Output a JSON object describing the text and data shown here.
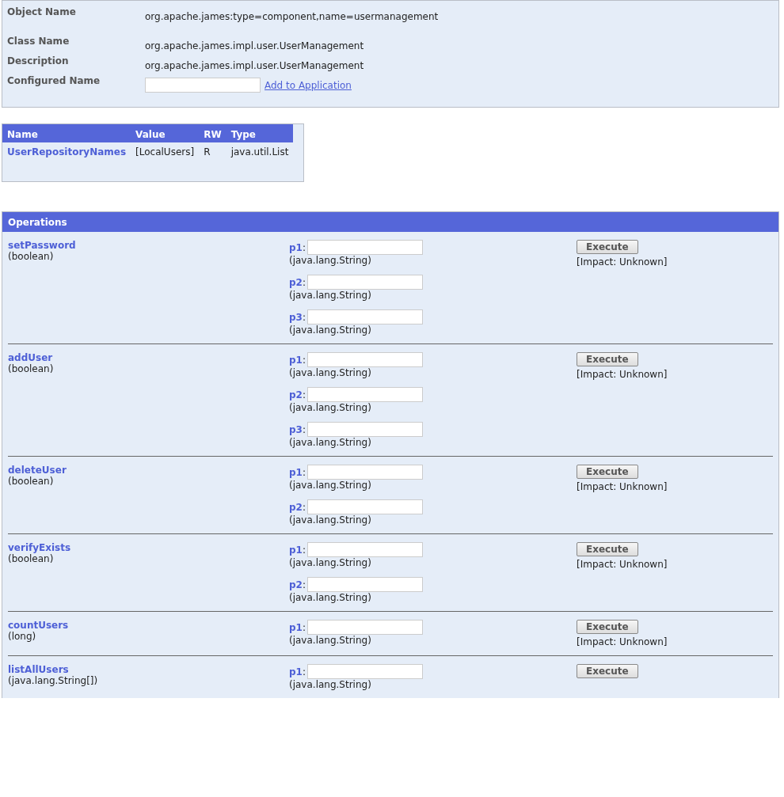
{
  "object_info": {
    "fields": [
      {
        "label": "Object Name",
        "value": "org.apache.james:type=component,name=usermanagement"
      },
      {
        "label": "Class Name",
        "value": "org.apache.james.impl.user.UserManagement"
      },
      {
        "label": "Description",
        "value": "org.apache.james.impl.user.UserManagement"
      }
    ],
    "configured_name": {
      "label": "Configured Name",
      "link": "Add to Application"
    }
  },
  "attributes": {
    "columns": [
      "Name",
      "Value",
      "RW",
      "Type"
    ],
    "rows": [
      [
        "UserRepositoryNames",
        "[LocalUsers]",
        "R",
        "java.util.List"
      ]
    ]
  },
  "operations": {
    "title": "Operations",
    "items": [
      {
        "name": "setPassword",
        "return_type": "(boolean)",
        "params": [
          {
            "label": "**p1**:",
            "type": "(java.lang.String)"
          },
          {
            "label": "**p2**:",
            "type": "(java.lang.String)"
          },
          {
            "label": "**p3**:",
            "type": "(java.lang.String)"
          }
        ],
        "button": "Execute",
        "impact": "[Impact: Unknown]"
      },
      {
        "name": "addUser",
        "return_type": "(boolean)",
        "params": [
          {
            "label": "**p1**:",
            "type": "(java.lang.String)"
          },
          {
            "label": "**p2**:",
            "type": "(java.lang.String)"
          },
          {
            "label": "**p3**:",
            "type": "(java.lang.String)"
          }
        ],
        "button": "Execute",
        "impact": "[Impact: Unknown]"
      },
      {
        "name": "deleteUser",
        "return_type": "(boolean)",
        "params": [
          {
            "label": "**p1**:",
            "type": "(java.lang.String)"
          },
          {
            "label": "**p2**:",
            "type": "(java.lang.String)"
          }
        ],
        "button": "Execute",
        "impact": "[Impact: Unknown]"
      },
      {
        "name": "verifyExists",
        "return_type": "(boolean)",
        "params": [
          {
            "label": "**p1**:",
            "type": "(java.lang.String)"
          },
          {
            "label": "**p2**:",
            "type": "(java.lang.String)"
          }
        ],
        "button": "Execute",
        "impact": "[Impact: Unknown]"
      },
      {
        "name": "countUsers",
        "return_type": "(long)",
        "params": [
          {
            "label": "**p1**:",
            "type": "(java.lang.String)"
          }
        ],
        "button": "Execute",
        "impact": "[Impact: Unknown]"
      },
      {
        "name": "listAllUsers",
        "return_type": "(java.lang.String[])",
        "params": [
          {
            "label": "**p1**:",
            "type": "(java.lang.String)"
          }
        ],
        "button": "Execute"
      }
    ]
  }
}
